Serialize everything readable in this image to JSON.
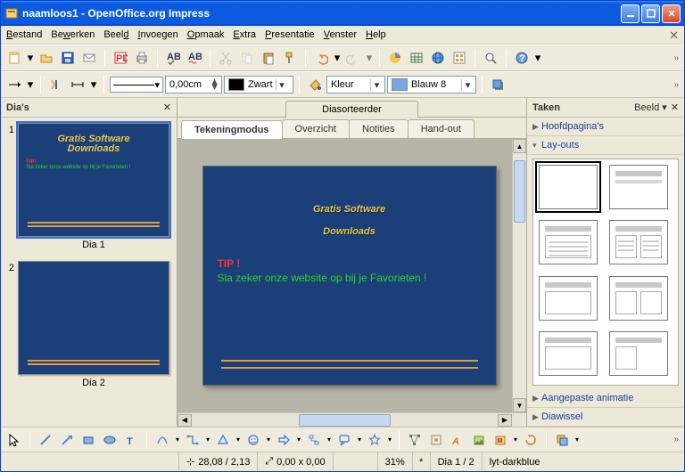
{
  "window": {
    "title": "naamloos1 - OpenOffice.org Impress"
  },
  "menu": {
    "items": [
      "Bestand",
      "Bewerken",
      "Beeld",
      "Invoegen",
      "Opmaak",
      "Extra",
      "Presentatie",
      "Venster",
      "Help"
    ],
    "underline_indices": [
      0,
      2,
      4,
      0,
      0,
      0,
      0,
      0,
      0
    ]
  },
  "line_toolbar": {
    "width_value": "0,00cm",
    "color_name": "Zwart",
    "color_hex": "#000000",
    "fill_type": "Kleur",
    "fill_name": "Blauw 8",
    "fill_hex": "#7aa7e0"
  },
  "slides_pane": {
    "title": "Dia's",
    "items": [
      {
        "num": "1",
        "label": "Dia 1",
        "selected": true,
        "title_line1": "Gratis Software",
        "title_line2": "Downloads",
        "tip": "TIP!",
        "body": "Sla zeker onze website op bij je Favorieten !"
      },
      {
        "num": "2",
        "label": "Dia 2",
        "selected": false,
        "title_line1": "",
        "title_line2": "",
        "tip": "",
        "body": ""
      }
    ]
  },
  "center": {
    "sorter_tab": "Diasorteerder",
    "tabs": [
      {
        "label": "Tekeningmodus",
        "active": true
      },
      {
        "label": "Overzicht",
        "active": false
      },
      {
        "label": "Notities",
        "active": false
      },
      {
        "label": "Hand-out",
        "active": false
      }
    ],
    "slide": {
      "title_line1": "Gratis Software",
      "title_line2": "Downloads",
      "tip": "TIP !",
      "body": "Sla zeker onze website op bij je Favorieten !"
    }
  },
  "tasks": {
    "title": "Taken",
    "view_label": "Beeld",
    "sections": {
      "master": "Hoofdpagina's",
      "layouts": "Lay-outs",
      "custom_anim": "Aangepaste animatie",
      "transition": "Diawissel"
    }
  },
  "status": {
    "pos": "28,08 / 2,13",
    "size": "0,00 x 0,00",
    "zoom": "31%",
    "modified": "*",
    "slide": "Dia 1 / 2",
    "template": "lyt-darkblue"
  }
}
